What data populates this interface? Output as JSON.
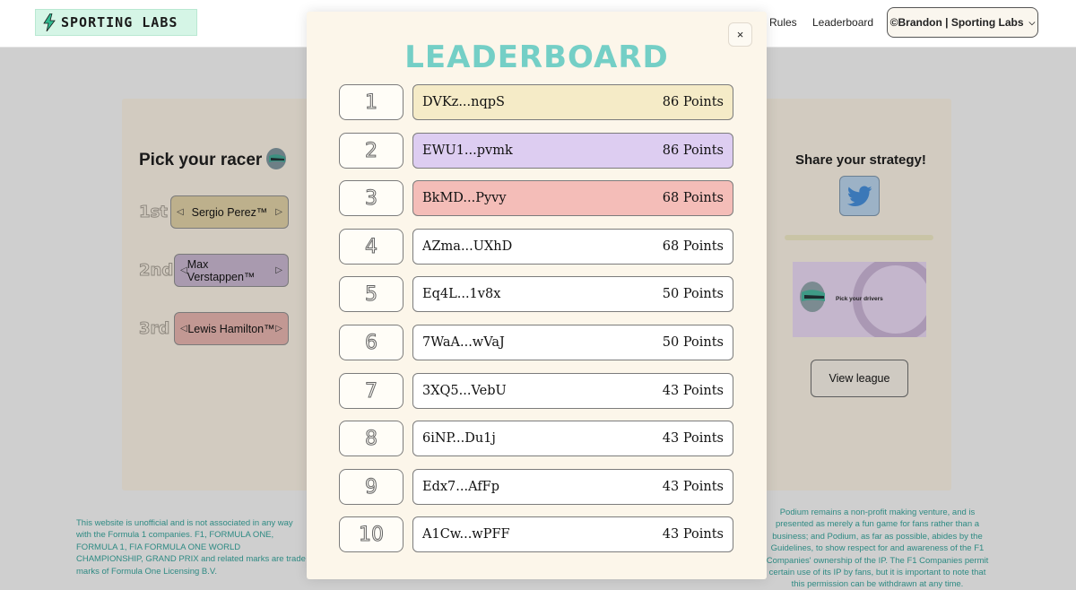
{
  "header": {
    "logo_text": "SPORTING LABS",
    "nav": [
      "Rules",
      "Leaderboard"
    ],
    "account_label": "©Brandon | Sporting Labs"
  },
  "picker": {
    "title": "Pick your racer",
    "slots": [
      {
        "place": "1st",
        "driver": "Sergio Perez™"
      },
      {
        "place": "2nd",
        "driver": "Max Verstappen™"
      },
      {
        "place": "3rd",
        "driver": "Lewis Hamilton™"
      }
    ]
  },
  "share": {
    "title": "Share your strategy!",
    "promo_text": "Pick your drivers",
    "view_league_label": "View league"
  },
  "disclaimer": {
    "left": "This website is unofficial and is not associated in any way with the Formula 1 companies. F1, FORMULA ONE, FORMULA 1, FIA FORMULA ONE WORLD CHAMPIONSHIP, GRAND PRIX and related marks are trade marks of Formula One Licensing B.V.",
    "right": "Podium remains a non-profit making venture, and is presented as merely a fun game for fans rather than a business; and Podium, as far as possible, abides by the Guidelines, to show respect for and awareness of the F1 Companies' ownership of the IP. The F1 Companies permit certain use of its IP by fans, but it is important to note that this permission can be withdrawn at any time."
  },
  "modal": {
    "title": "LEADERBOARD",
    "close_label": "×",
    "entries": [
      {
        "rank": "1",
        "name": "DVKz...nqpS",
        "points": "86 Points",
        "color": "#f5ebc7"
      },
      {
        "rank": "2",
        "name": "EWU1...pvmk",
        "points": "86 Points",
        "color": "#ddcdf1"
      },
      {
        "rank": "3",
        "name": "BkMD...Pyvy",
        "points": "68 Points",
        "color": "#f4bdb8"
      },
      {
        "rank": "4",
        "name": "AZma...UXhD",
        "points": "68 Points",
        "color": "#ffffff"
      },
      {
        "rank": "5",
        "name": "Eq4L...1v8x",
        "points": "50 Points",
        "color": "#ffffff"
      },
      {
        "rank": "6",
        "name": "7WaA...wVaJ",
        "points": "50 Points",
        "color": "#ffffff"
      },
      {
        "rank": "7",
        "name": "3XQ5...VebU",
        "points": "43 Points",
        "color": "#ffffff"
      },
      {
        "rank": "8",
        "name": "6iNP...Du1j",
        "points": "43 Points",
        "color": "#ffffff"
      },
      {
        "rank": "9",
        "name": "Edx7...AfFp",
        "points": "43 Points",
        "color": "#ffffff"
      },
      {
        "rank": "10",
        "name": "A1Cw...wPFF",
        "points": "43 Points",
        "color": "#ffffff"
      }
    ]
  }
}
